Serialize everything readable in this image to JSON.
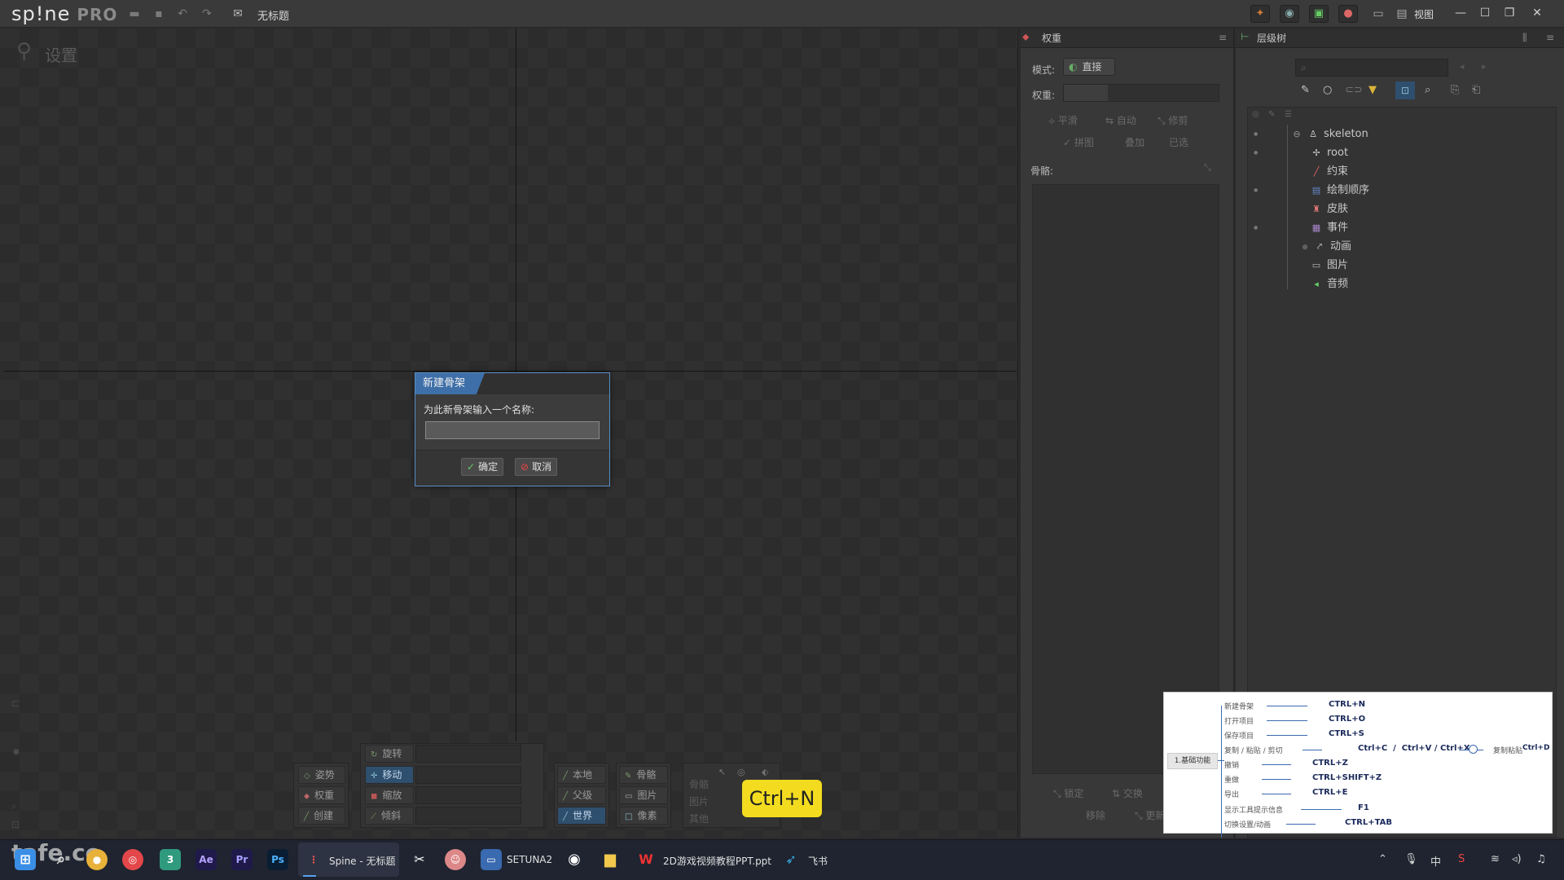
{
  "app": {
    "logo": "sp!ne",
    "edition": "PRO",
    "doc_title": "无标题",
    "view_label": "视图"
  },
  "viewport": {
    "mode_label": "设置"
  },
  "dialog": {
    "title": "新建骨架",
    "prompt": "为此新骨架输入一个名称:",
    "input_value": "",
    "ok_label": "确定",
    "cancel_label": "取消"
  },
  "tools": {
    "left": [
      "姿势",
      "权重",
      "创建"
    ],
    "transform": [
      "旋转",
      "移动",
      "缩放",
      "倾斜"
    ],
    "axes": [
      "本地",
      "父级",
      "世界"
    ],
    "compensate": [
      "骨骼",
      "图片",
      "像素"
    ],
    "options": [
      "骨骼",
      "图片",
      "其他"
    ]
  },
  "weights": {
    "title": "权重",
    "mode_label": "模式:",
    "mode_value": "直接",
    "weight_label": "权重:",
    "row1": [
      "平滑",
      "自动",
      "修剪"
    ],
    "row2": [
      "拼图",
      "叠加",
      "已选"
    ],
    "bones_label": "骨骼:",
    "footer": [
      "锁定",
      "交换",
      "移除",
      "更新"
    ]
  },
  "tree": {
    "title": "层级树",
    "items": [
      {
        "label": "skeleton",
        "icon": "skeleton-icon"
      },
      {
        "label": "root",
        "icon": "bone-icon"
      },
      {
        "label": "约束",
        "icon": "constraint-icon"
      },
      {
        "label": "绘制顺序",
        "icon": "draw-order-icon"
      },
      {
        "label": "皮肤",
        "icon": "skin-icon"
      },
      {
        "label": "事件",
        "icon": "event-icon"
      },
      {
        "label": "动画",
        "icon": "animation-icon"
      },
      {
        "label": "图片",
        "icon": "image-icon"
      },
      {
        "label": "音频",
        "icon": "audio-icon"
      }
    ]
  },
  "shortcuts": {
    "group": "1.基础功能",
    "rows": [
      {
        "label": "新建骨架",
        "key": "CTRL+N"
      },
      {
        "label": "打开项目",
        "key": "CTRL+O"
      },
      {
        "label": "保存项目",
        "key": "CTRL+S"
      },
      {
        "label": "复制 / 粘贴 / 剪切",
        "key": "Ctrl+C  /  Ctrl+V / Ctrl+X"
      },
      {
        "label": "撤销",
        "key": "CTRL+Z"
      },
      {
        "label": "重做",
        "key": "CTRL+SHIFT+Z"
      },
      {
        "label": "导出",
        "key": "CTRL+E"
      },
      {
        "label": "显示工具提示信息",
        "key": "F1"
      },
      {
        "label": "切换设置/动画",
        "key": "CTRL+TAB"
      }
    ],
    "extra_label": "复制粘贴",
    "extra_key": "Ctrl+D",
    "badge": "Ctrl+N"
  },
  "taskbar": {
    "watermark": "tafe.cc",
    "spine_label": "Spine - 无标题",
    "setuna_label": "SETUNA2",
    "ppt_label": "2D游戏视频教程PPT.ppt",
    "feishu_label": "飞书",
    "ime": "中",
    "ae": "Ae",
    "pr": "Pr",
    "ps": "Ps"
  },
  "colors": {
    "accent": "#3e6fa8",
    "badge": "#f3dc1f"
  }
}
